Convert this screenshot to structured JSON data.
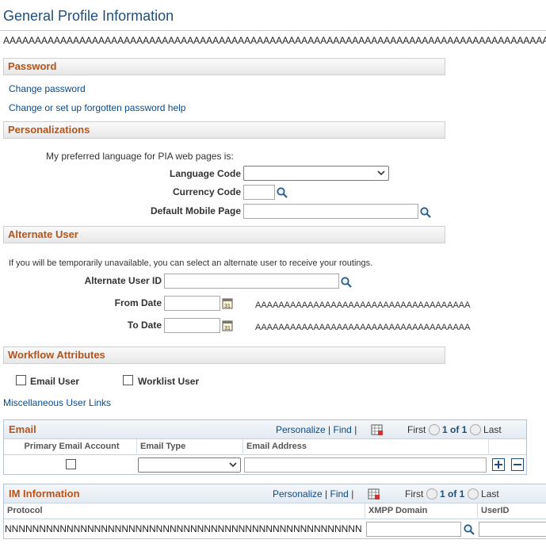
{
  "page": {
    "title": "General Profile Information",
    "filler_line": "AAAAAAAAAAAAAAAAAAAAAAAAAAAAAAAAAAAAAAAAAAAAAAAAAAAAAAAAAAAAAAAAAAAAAAAAAAAAAAAAAAAAAAAA"
  },
  "password": {
    "header": "Password",
    "change_password": "Change password",
    "forgotten_help": "Change or set up forgotten password help"
  },
  "personalizations": {
    "header": "Personalizations",
    "intro": "My preferred language for PIA web pages is:",
    "language_code_label": "Language Code",
    "language_code_value": "",
    "currency_code_label": "Currency Code",
    "currency_code_value": "",
    "default_mobile_label": "Default Mobile Page",
    "default_mobile_value": ""
  },
  "alternate_user": {
    "header": "Alternate User",
    "intro": "If you will be temporarily unavailable, you can select an alternate user to receive your routings.",
    "user_id_label": "Alternate User ID",
    "user_id_value": "",
    "from_date_label": "From Date",
    "from_date_value": "",
    "from_date_hint": "AAAAAAAAAAAAAAAAAAAAAAAAAAAAAAAAAAAAA",
    "to_date_label": "To Date",
    "to_date_value": "",
    "to_date_hint": "AAAAAAAAAAAAAAAAAAAAAAAAAAAAAAAAAAAAA"
  },
  "workflow": {
    "header": "Workflow Attributes",
    "email_user_label": "Email User",
    "email_user_checked": false,
    "worklist_user_label": "Worklist User",
    "worklist_user_checked": false
  },
  "misc_links": "Miscellaneous User Links",
  "email_grid": {
    "title": "Email",
    "personalize": "Personalize",
    "separator": "|",
    "find": "Find",
    "first": "First",
    "range": "1 of 1",
    "last": "Last",
    "columns": [
      "Primary Email Account",
      "Email Type",
      "Email Address"
    ],
    "row": {
      "primary": false,
      "email_type": "",
      "email_address": ""
    }
  },
  "im_grid": {
    "title": "IM Information",
    "personalize": "Personalize",
    "separator": "|",
    "find": "Find",
    "first": "First",
    "range": "1 of 1",
    "last": "Last",
    "columns": [
      "Protocol",
      "XMPP Domain",
      "UserID"
    ],
    "row": {
      "protocol": "NNNNNNNNNNNNNNNNNNNNNNNNNNNNNNNNNNNNNNNNNNNNNNNNNNNN",
      "xmpp_domain": "",
      "userid": ""
    }
  },
  "icons": {
    "lookup": "magnifier-icon",
    "calendar": "calendar-icon",
    "add_row": "plus-icon",
    "delete_row": "minus-icon",
    "grid_download": "grid-icon"
  },
  "colors": {
    "section_header_text": "#b5541a",
    "link": "#0b4a86",
    "title": "#1f4e79"
  }
}
